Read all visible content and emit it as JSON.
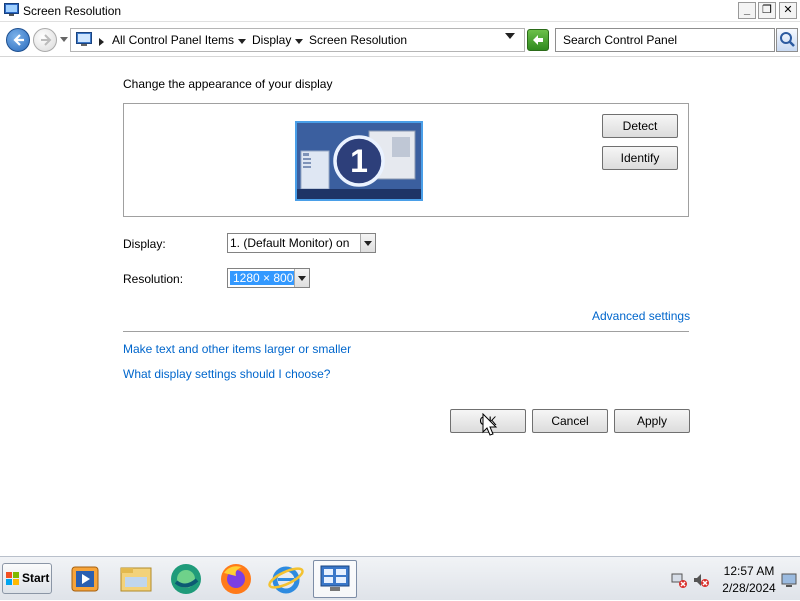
{
  "window": {
    "title": "Screen Resolution",
    "controls": {
      "minimize": "_",
      "restore": "❐",
      "close": "✕"
    }
  },
  "address": {
    "breadcrumb": [
      "All Control Panel Items",
      "Display",
      "Screen Resolution"
    ],
    "search_placeholder": "Search Control Panel"
  },
  "main": {
    "heading": "Change the appearance of your display",
    "monitor_number": "1",
    "detect_label": "Detect",
    "identify_label": "Identify",
    "display_label": "Display:",
    "display_value": "1. (Default Monitor) on",
    "resolution_label": "Resolution:",
    "resolution_value": "1280 × 800",
    "advanced_link": "Advanced settings",
    "link_text_size": "Make text and other items larger or smaller",
    "link_help": "What display settings should I choose?",
    "ok_label": "OK",
    "cancel_label": "Cancel",
    "apply_label": "Apply"
  },
  "taskbar": {
    "start_label": "Start",
    "apps": [
      "media-player-icon",
      "file-explorer-icon",
      "edge-icon",
      "firefox-icon",
      "internet-explorer-icon",
      "control-panel-icon"
    ],
    "clock_time": "12:57 AM",
    "clock_date": "2/28/2024"
  },
  "colors": {
    "link": "#0066cc",
    "selection": "#3399ff",
    "monitor_border": "#4a9fe8"
  }
}
